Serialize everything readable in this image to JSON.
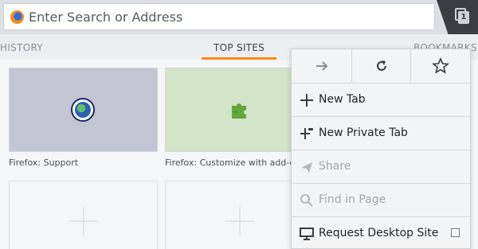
{
  "toolbar": {
    "url_placeholder": "Enter Search or Address",
    "tabs_count": "1"
  },
  "panels": {
    "history": "HISTORY",
    "top_sites": "TOP SITES",
    "bookmarks": "BOOKMARKS"
  },
  "top_sites": [
    {
      "label": "Firefox: Support",
      "icon": "globe-icon"
    },
    {
      "label": "Firefox: Customize with add-ons",
      "icon": "puzzle-icon"
    }
  ],
  "menu": {
    "actions": [
      "forward-icon",
      "reload-icon",
      "bookmark-star-icon"
    ],
    "items": [
      {
        "label": "New Tab",
        "icon": "plus-icon",
        "enabled": true
      },
      {
        "label": "New Private Tab",
        "icon": "private-tab-icon",
        "enabled": true
      },
      {
        "label": "Share",
        "icon": "share-icon",
        "enabled": false
      },
      {
        "label": "Find in Page",
        "icon": "search-icon",
        "enabled": false
      },
      {
        "label": "Request Desktop Site",
        "icon": "desktop-icon",
        "enabled": true,
        "checked": false
      }
    ]
  },
  "colors": {
    "accent": "#f68a1f",
    "tile_support": "#c3c4d4",
    "tile_addons": "#d2e4c8"
  }
}
